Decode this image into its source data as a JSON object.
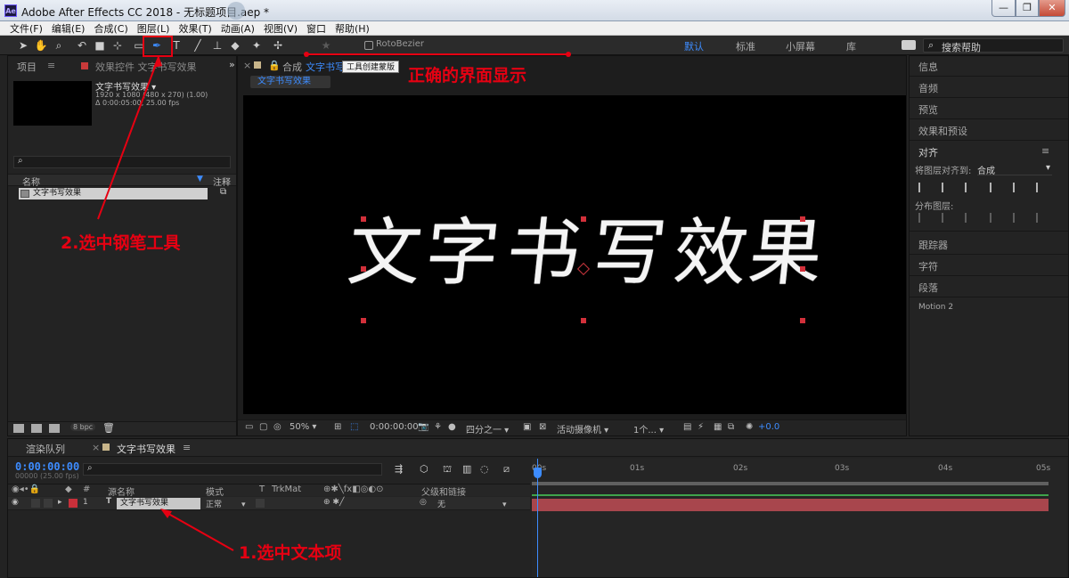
{
  "window": {
    "title": "Adobe After Effects CC 2018 - 无标题项目.aep *",
    "app_icon": "Ae",
    "buttons": [
      "—",
      "❐",
      "✕"
    ]
  },
  "menu": [
    "文件(F)",
    "编辑(E)",
    "合成(C)",
    "图层(L)",
    "效果(T)",
    "动画(A)",
    "视图(V)",
    "窗口",
    "帮助(H)"
  ],
  "toolbar": {
    "roto_label": "RotoBezier",
    "workspaces": [
      "默认",
      "标准",
      "小屏幕",
      "库"
    ],
    "active_workspace": "默认",
    "search_placeholder": "搜索帮助",
    "tooltip": "工具创建蒙版"
  },
  "project": {
    "tab_project": "项目",
    "tab_effects": "效果控件 文字书写效果",
    "comp_name": "文字书写效果",
    "info_line1": "1920 x 1080  (480 x 270) (1.00)",
    "info_line2": "Δ 0:00:05:00, 25.00 fps",
    "col_name": "名称",
    "col_comment": "注释",
    "item_name": "文字书写效果",
    "bpc": "8 bpc"
  },
  "comp": {
    "tab_prefix": "合成",
    "tab_name": "文字书写效果",
    "subtab": "文字书写效果",
    "text": [
      "文",
      "字",
      "书",
      "写",
      "效",
      "果"
    ],
    "zoom": "50%",
    "time": "0:00:00:00",
    "resolution": "四分之一",
    "camera": "活动摄像机",
    "views": "1个...",
    "exposure": "+0.0"
  },
  "right_panel": {
    "items": [
      "信息",
      "音频",
      "预览",
      "效果和预设"
    ],
    "align_title": "对齐",
    "align_to_label": "将图层对齐到:",
    "align_to_value": "合成",
    "distribute_label": "分布图层:",
    "items2": [
      "跟踪器",
      "字符",
      "段落",
      "Motion 2"
    ]
  },
  "timeline": {
    "tab_render": "渲染队列",
    "tab_comp": "文字书写效果",
    "timecode": "0:00:00:00",
    "timecode_sub": "00000 (25.00 fps)",
    "cols": {
      "num": "#",
      "source": "源名称",
      "mode": "模式",
      "t": "T",
      "trkmat": "TrkMat",
      "parent": "父级和链接"
    },
    "layer": {
      "index": "1",
      "type": "T",
      "name": "文字书写效果",
      "mode": "正常",
      "parent": "无"
    },
    "ruler_ticks": [
      "00s",
      "01s",
      "02s",
      "03s",
      "04s",
      "05s"
    ]
  },
  "annotations": {
    "correct": "正确的界面显示",
    "step2": "2.选中钢笔工具",
    "step1": "1.选中文本项"
  },
  "colors": {
    "accent": "#3d8cff",
    "annotation": "#e60012",
    "layer_bar": "#a8464d"
  }
}
